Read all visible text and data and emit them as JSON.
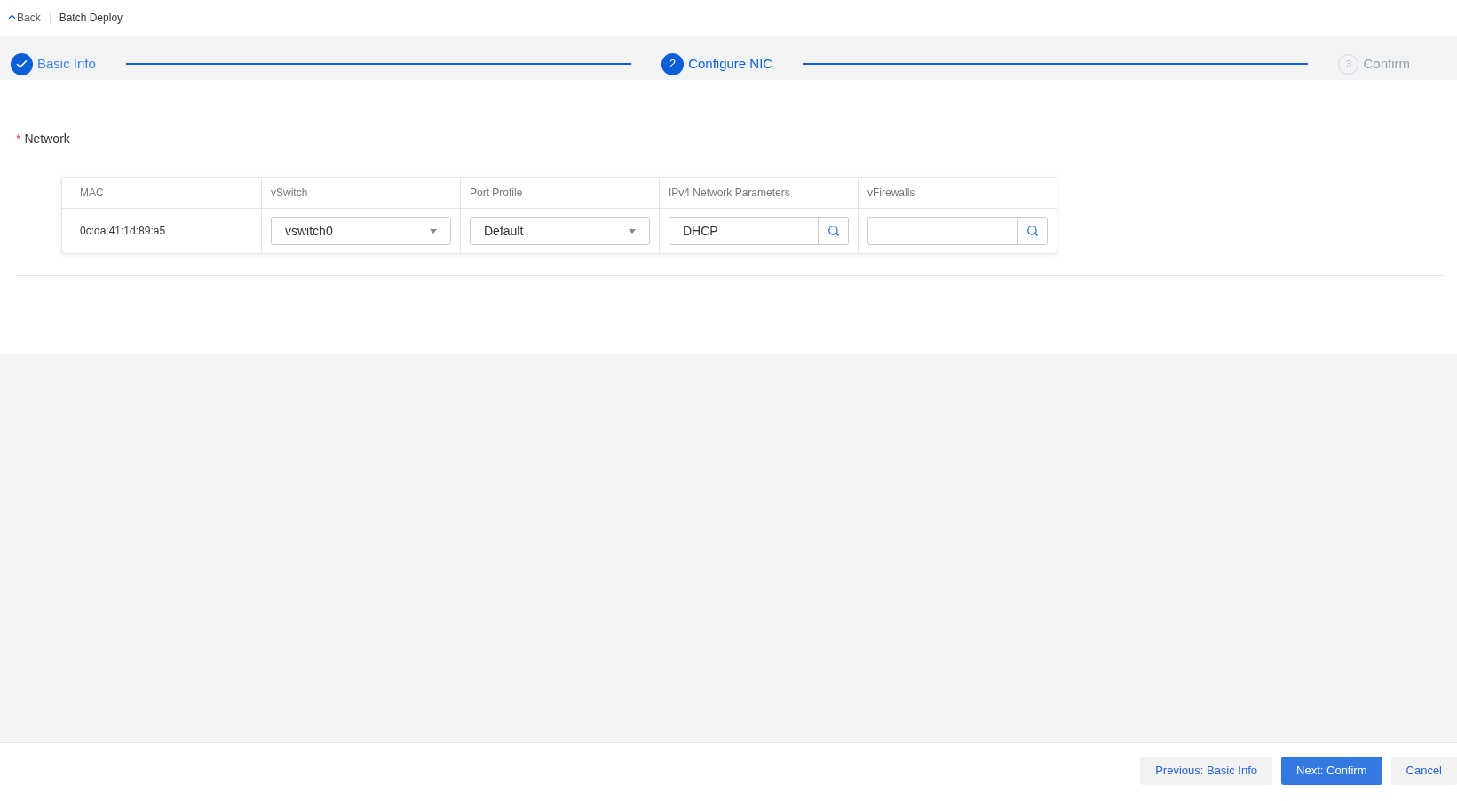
{
  "header": {
    "back": "Back",
    "title": "Batch Deploy"
  },
  "steps": [
    {
      "label": "Basic Info",
      "completed": true,
      "selected": false
    },
    {
      "number": "2",
      "label": "Configure NIC",
      "completed": false,
      "selected": true
    },
    {
      "number": "3",
      "label": "Confirm",
      "completed": false,
      "selected": false
    }
  ],
  "network": {
    "required_mark": "*",
    "label": "Network",
    "columns": [
      "MAC",
      "vSwitch",
      "Port Profile",
      "IPv4 Network Parameters",
      "vFirewalls"
    ],
    "rows": [
      {
        "mac": "0c:da:41:1d:89:a5",
        "vswitch": "vswitch0",
        "port_profile": "Default",
        "ipv4": "DHCP",
        "vfirewalls": ""
      }
    ]
  },
  "footer": {
    "buttons": [
      {
        "label": "Previous: Basic Info",
        "kind": "secondary"
      },
      {
        "label": "Next: Confirm",
        "kind": "primary"
      },
      {
        "label": "Cancel",
        "kind": "secondary"
      }
    ]
  }
}
